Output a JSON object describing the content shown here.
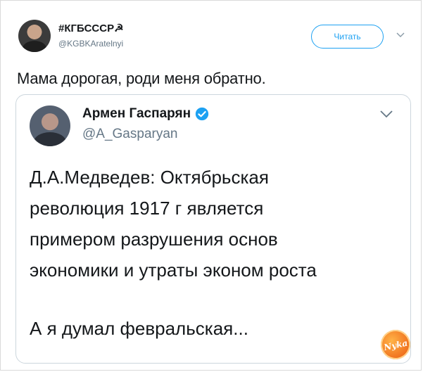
{
  "tweet": {
    "author_name": "#КГБСССР☭",
    "author_handle": "@KGBKAratelnyi",
    "follow_label": "Читать",
    "text": "Мама дорогая, роди меня обратно."
  },
  "quoted": {
    "author_name": "Армен Гаспарян",
    "author_handle": "@A_Gasparyan",
    "verified": true,
    "lines": [
      "Д.А.Медведев: Октябрьская",
      "революция 1917 г является",
      "примером разрушения основ",
      "экономики и утраты эконом роста"
    ],
    "last_line": "А я думал февральская..."
  },
  "watermark": {
    "text": "Nyka"
  },
  "colors": {
    "accent": "#1da1f2",
    "muted": "#657786",
    "border": "#ccd6dd"
  },
  "icons": {
    "verified": "verified-badge-icon",
    "menu": "chevron-down-icon"
  }
}
